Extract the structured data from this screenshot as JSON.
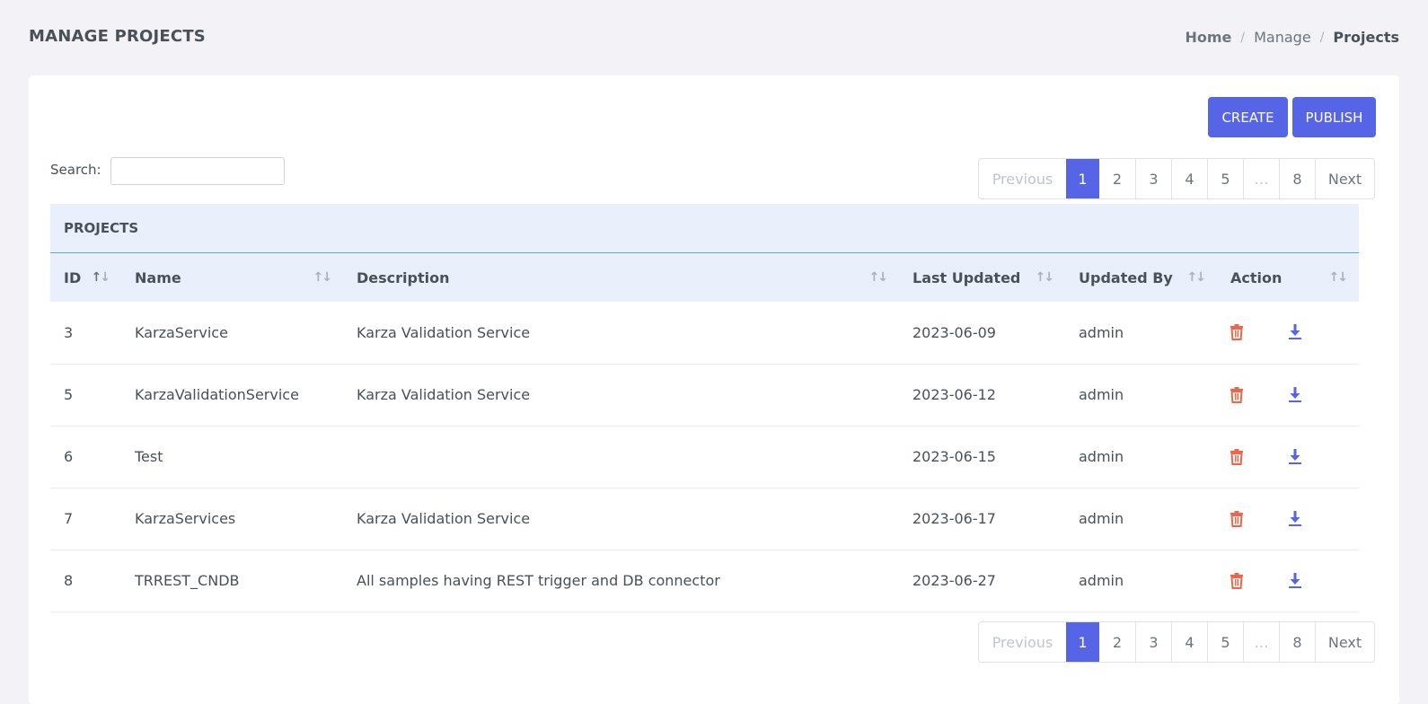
{
  "header": {
    "title": "MANAGE PROJECTS",
    "breadcrumb": [
      "Home",
      "Manage",
      "Projects"
    ],
    "breadcrumb_sep": "/"
  },
  "toolbar": {
    "create_label": "CREATE",
    "publish_label": "PUBLISH"
  },
  "search": {
    "label": "Search:",
    "value": "",
    "placeholder": ""
  },
  "pagination": {
    "previous": "Previous",
    "pages": [
      "1",
      "2",
      "3",
      "4",
      "5",
      "…",
      "8"
    ],
    "active": "1",
    "next": "Next"
  },
  "table": {
    "caption": "PROJECTS",
    "columns": [
      "ID",
      "Name",
      "Description",
      "Last Updated",
      "Updated By",
      "Action"
    ],
    "rows": [
      {
        "id": "3",
        "name": "KarzaService",
        "description": "Karza Validation Service",
        "last_updated": "2023-06-09",
        "updated_by": "admin"
      },
      {
        "id": "5",
        "name": "KarzaValidationService",
        "description": "Karza Validation Service",
        "last_updated": "2023-06-12",
        "updated_by": "admin"
      },
      {
        "id": "6",
        "name": "Test",
        "description": "",
        "last_updated": "2023-06-15",
        "updated_by": "admin"
      },
      {
        "id": "7",
        "name": "KarzaServices",
        "description": "Karza Validation Service",
        "last_updated": "2023-06-17",
        "updated_by": "admin"
      },
      {
        "id": "8",
        "name": "TRREST_CNDB",
        "description": "All samples having REST trigger and DB connector",
        "last_updated": "2023-06-27",
        "updated_by": "admin"
      }
    ],
    "row_actions": [
      "trash-icon",
      "download-icon"
    ]
  },
  "colors": {
    "primary": "#5664e6",
    "danger": "#f06548",
    "header_bg": "#eaf0fb"
  }
}
